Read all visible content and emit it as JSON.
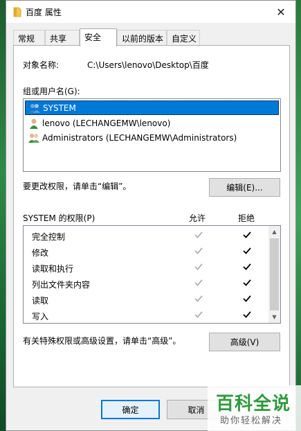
{
  "window": {
    "title": "百度 属性",
    "close_glyph": "✕"
  },
  "tabs": [
    {
      "label": "常规"
    },
    {
      "label": "共享"
    },
    {
      "label": "安全"
    },
    {
      "label": "以前的版本"
    },
    {
      "label": "自定义"
    }
  ],
  "object": {
    "label": "对象名称:",
    "path": "C:\\Users\\lenovo\\Desktop\\百度"
  },
  "groups": {
    "label": "组或用户名(G):",
    "items": [
      {
        "name": "SYSTEM",
        "icon": "user-group-icon"
      },
      {
        "name": "lenovo (LECHANGEMW\\lenovo)",
        "icon": "user-icon"
      },
      {
        "name": "Administrators (LECHANGEMW\\Administrators)",
        "icon": "user-group-icon"
      }
    ],
    "selected": 0
  },
  "edit": {
    "hint": "要更改权限，请单击“编辑”。",
    "button": "编辑(E)..."
  },
  "permissions": {
    "title": "SYSTEM 的权限(P)",
    "allow_header": "允许",
    "deny_header": "拒绝",
    "rows": [
      {
        "name": "完全控制",
        "allow": true,
        "deny": true
      },
      {
        "name": "修改",
        "allow": true,
        "deny": true
      },
      {
        "name": "读取和执行",
        "allow": true,
        "deny": true
      },
      {
        "name": "列出文件夹内容",
        "allow": true,
        "deny": true
      },
      {
        "name": "读取",
        "allow": true,
        "deny": true
      },
      {
        "name": "写入",
        "allow": true,
        "deny": true
      }
    ]
  },
  "advanced": {
    "hint": "有关特殊权限或高级设置，请单击“高级”。",
    "button": "高级(V)"
  },
  "footer": {
    "ok": "确定",
    "cancel": "取消"
  },
  "watermark": {
    "big": "百科全说",
    "small": "助你轻松解决"
  },
  "colors": {
    "accent": "#0078d7",
    "disabled_check": "#b0b0b0",
    "watermark_green": "#2e9a3c"
  }
}
